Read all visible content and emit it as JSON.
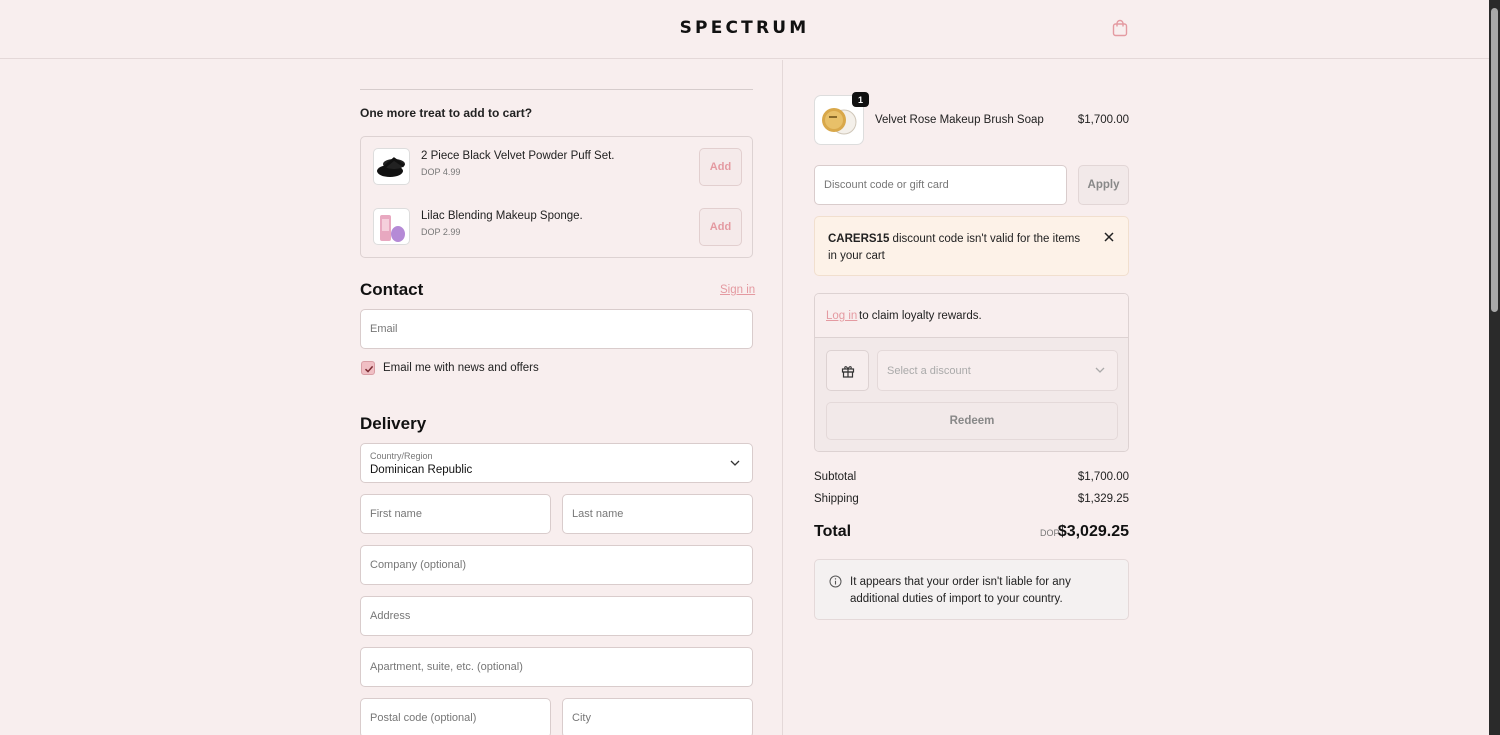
{
  "header": {
    "logo": "SPECTRUM",
    "cart_icon": "shopping-bag-icon"
  },
  "upsell": {
    "title": "One more treat to add to cart?",
    "items": [
      {
        "name": "2 Piece Black Velvet Powder Puff Set.",
        "price": "DOP 4.99",
        "add_label": "Add"
      },
      {
        "name": "Lilac Blending Makeup Sponge.",
        "price": "DOP 2.99",
        "add_label": "Add"
      }
    ]
  },
  "contact": {
    "heading": "Contact",
    "sign_in": "Sign in",
    "email_placeholder": "Email",
    "newsletter_label": "Email me with news and offers",
    "newsletter_checked": true
  },
  "delivery": {
    "heading": "Delivery",
    "country_label": "Country/Region",
    "country_value": "Dominican Republic",
    "first_name": "First name",
    "last_name": "Last name",
    "company": "Company (optional)",
    "address": "Address",
    "apartment": "Apartment, suite, etc. (optional)",
    "postal_code": "Postal code (optional)",
    "city": "City"
  },
  "order": {
    "product": {
      "name": "Velvet Rose Makeup Brush Soap",
      "price": "$1,700.00",
      "quantity": "1"
    },
    "discount_placeholder": "Discount code or gift card",
    "apply_label": "Apply",
    "alert": {
      "code": "CARERS15",
      "message": " discount code isn't valid for the items in your cart"
    },
    "loyalty": {
      "login_link": "Log in",
      "login_text": "to claim loyalty rewards.",
      "select_placeholder": "Select a discount",
      "redeem_label": "Redeem"
    },
    "subtotal_label": "Subtotal",
    "subtotal_value": "$1,700.00",
    "shipping_label": "Shipping",
    "shipping_value": "$1,329.25",
    "total_label": "Total",
    "total_currency": "DOP",
    "total_value": "$3,029.25",
    "info": "It appears that your order isn't liable for any additional duties of import to your country."
  },
  "colors": {
    "accent": "#e49aa1",
    "background": "#f8eeee"
  }
}
